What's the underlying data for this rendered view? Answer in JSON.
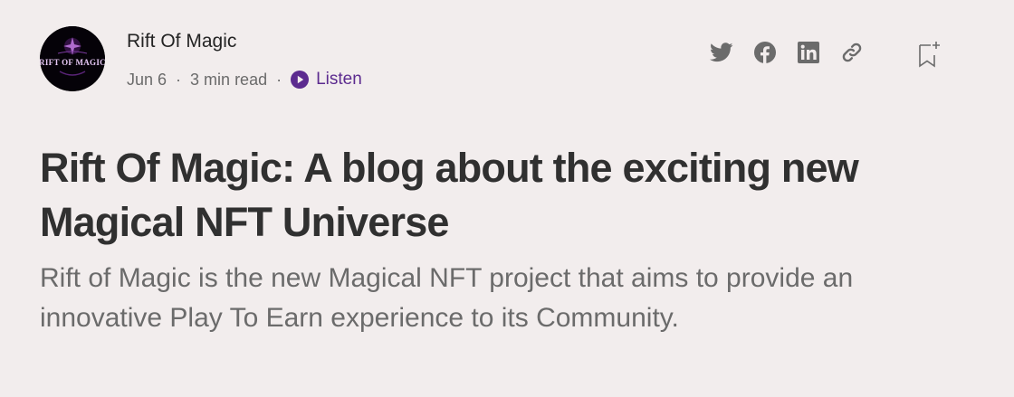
{
  "header": {
    "author_name": "Rift Of Magic",
    "avatar_text": "RIFT OF MAGIC",
    "date": "Jun 6",
    "separator": "·",
    "read_time": "3 min read",
    "listen_label": "Listen"
  },
  "share": {
    "icons": [
      "twitter-icon",
      "facebook-icon",
      "linkedin-icon",
      "link-icon"
    ],
    "bookmark_icon": "bookmark-add-icon"
  },
  "article": {
    "title": "Rift Of Magic: A blog about the exciting new Magical NFT Universe",
    "subtitle": "Rift of Magic is the new Magical NFT project that aims to provide an innovative Play To Earn experience to its Community."
  },
  "colors": {
    "background": "#f2eded",
    "listen_accent": "#5c2b8f",
    "icon_gray": "#6b6b6b",
    "title": "#303030"
  }
}
